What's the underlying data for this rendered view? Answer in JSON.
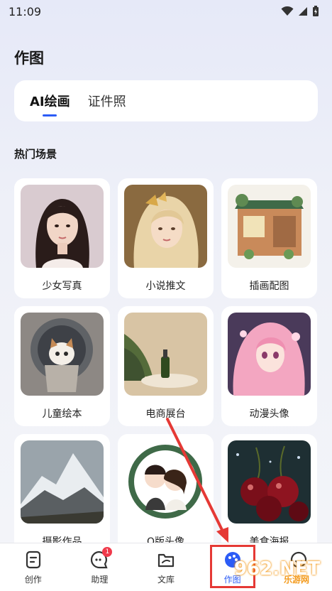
{
  "status_bar": {
    "time": "11:09"
  },
  "page": {
    "title": "作图"
  },
  "tabs": [
    {
      "label": "AI绘画",
      "active": true
    },
    {
      "label": "证件照",
      "active": false
    }
  ],
  "section": {
    "title": "热门场景"
  },
  "scenes": [
    {
      "label": "少女写真",
      "icon": "portrait-girl-image"
    },
    {
      "label": "小说推文",
      "icon": "fantasy-girl-image"
    },
    {
      "label": "插画配图",
      "icon": "storefront-illustration-image"
    },
    {
      "label": "儿童绘本",
      "icon": "cartoon-cat-image"
    },
    {
      "label": "电商展台",
      "icon": "product-display-image"
    },
    {
      "label": "动漫头像",
      "icon": "anime-avatar-image"
    },
    {
      "label": "摄影作品",
      "icon": "mountain-photo-image"
    },
    {
      "label": "Q版头像",
      "icon": "chibi-couple-image"
    },
    {
      "label": "美食海报",
      "icon": "cherries-poster-image"
    }
  ],
  "bottom_nav": [
    {
      "label": "创作",
      "icon": "document-icon",
      "active": false
    },
    {
      "label": "助理",
      "icon": "chat-bubble-icon",
      "active": false,
      "badge": "1"
    },
    {
      "label": "文库",
      "icon": "folder-icon",
      "active": false
    },
    {
      "label": "作图",
      "icon": "palette-icon",
      "active": true
    },
    {
      "label": "",
      "icon": "profile-icon",
      "active": false
    }
  ],
  "watermark": {
    "text": "962.NET",
    "sub": "乐游网"
  },
  "colors": {
    "accent": "#2c5cf6",
    "badge": "#f03a4b",
    "annotation": "#e53935"
  }
}
